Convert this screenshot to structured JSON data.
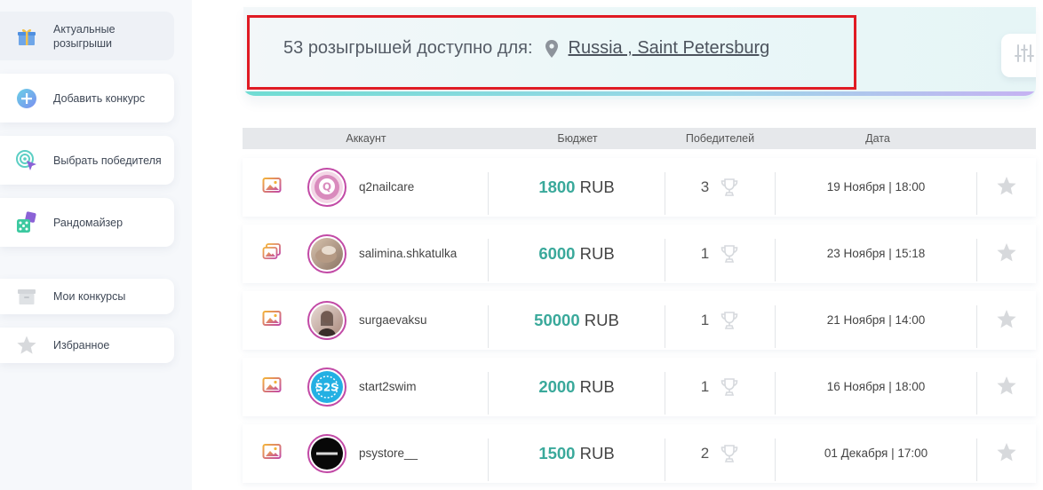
{
  "sidebar": {
    "items": [
      {
        "label": "Актуальные розыгрыши",
        "icon": "gift-icon",
        "active": true
      },
      {
        "label": "Добавить конкурс",
        "icon": "plus-circle-icon"
      },
      {
        "label": "Выбрать победителя",
        "icon": "target-cursor-icon"
      },
      {
        "label": "Рандомайзер",
        "icon": "dice-icon"
      },
      {
        "label": "Мои конкурсы",
        "icon": "archive-box-icon"
      },
      {
        "label": "Избранное",
        "icon": "star-icon"
      }
    ]
  },
  "banner": {
    "count": "53",
    "text": "розыгрышей доступно для:",
    "location": "Russia , Saint Petersburg",
    "filter_icon": "sliders-icon"
  },
  "table": {
    "headers": [
      "Аккаунт",
      "Бюджет",
      "Победителей",
      "Дата"
    ],
    "currency": "RUB",
    "rows": [
      {
        "account": "q2nailcare",
        "budget": "1800",
        "winners": "3",
        "date": "19 Ноября | 18:00",
        "media": "single"
      },
      {
        "account": "salimina.shkatulka",
        "budget": "6000",
        "winners": "1",
        "date": "23 Ноября | 15:18",
        "media": "multiple"
      },
      {
        "account": "surgaevaksu",
        "budget": "50000",
        "winners": "1",
        "date": "21 Ноября | 14:00",
        "media": "single"
      },
      {
        "account": "start2swim",
        "budget": "2000",
        "winners": "1",
        "date": "16 Ноября | 18:00",
        "media": "single"
      },
      {
        "account": "psystore__",
        "budget": "1500",
        "winners": "2",
        "date": "01 Декабря | 17:00",
        "media": "single"
      }
    ]
  },
  "colors": {
    "accent": "#3aa99b",
    "highlight": "#e01b24",
    "avatar_ring": "#c24aa6"
  }
}
